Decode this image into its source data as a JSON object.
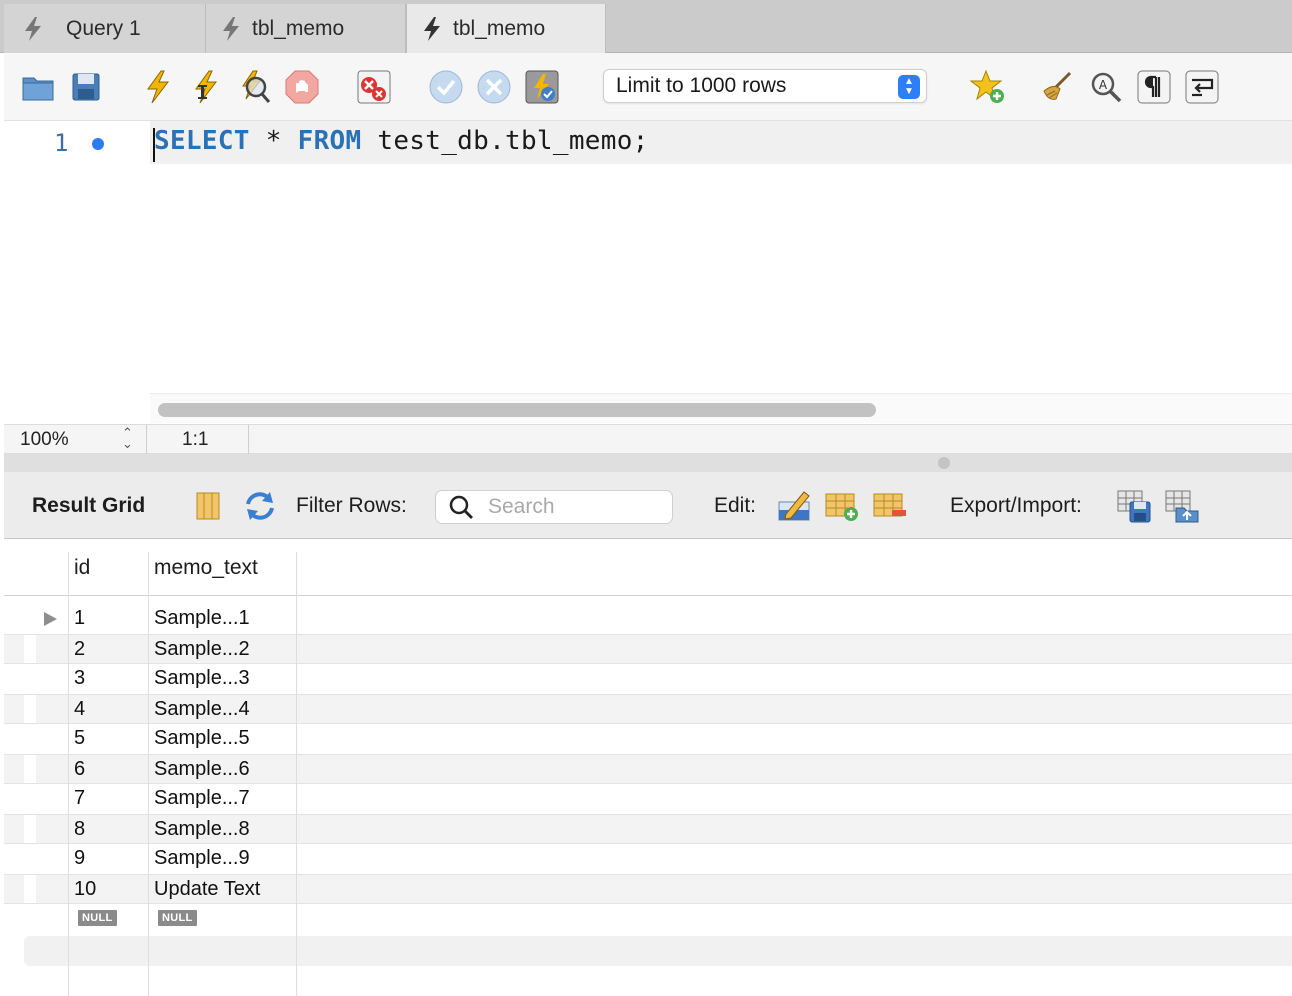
{
  "tabs": [
    {
      "label": "Query 1",
      "active": false
    },
    {
      "label": "tbl_memo",
      "active": false
    },
    {
      "label": "tbl_memo",
      "active": true
    }
  ],
  "toolbar": {
    "icons": [
      "open-folder-icon",
      "save-icon",
      "execute-icon",
      "execute-current-icon",
      "explain-icon",
      "stop-icon",
      "toggle-continue-on-error-icon",
      "commit-icon",
      "rollback-icon",
      "autocommit-icon",
      "add-snippet-icon",
      "beautify-icon",
      "find-icon",
      "invisible-chars-icon",
      "word-wrap-icon"
    ],
    "limit_label": "Limit to 1000 rows"
  },
  "editor": {
    "line_number": "1",
    "code_keyword1": "SELECT",
    "code_mid": " * ",
    "code_keyword2": "FROM",
    "code_rest": " test_db.tbl_memo;"
  },
  "statusbar": {
    "zoom": "100%",
    "position": "1:1"
  },
  "result": {
    "title": "Result Grid",
    "filter_label": "Filter Rows:",
    "search_placeholder": "Search",
    "edit_label": "Edit:",
    "export_label": "Export/Import:",
    "columns": [
      "id",
      "memo_text"
    ],
    "rows": [
      {
        "id": "1",
        "memo_text": "Sample...1"
      },
      {
        "id": "2",
        "memo_text": "Sample...2"
      },
      {
        "id": "3",
        "memo_text": "Sample...3"
      },
      {
        "id": "4",
        "memo_text": "Sample...4"
      },
      {
        "id": "5",
        "memo_text": "Sample...5"
      },
      {
        "id": "6",
        "memo_text": "Sample...6"
      },
      {
        "id": "7",
        "memo_text": "Sample...7"
      },
      {
        "id": "8",
        "memo_text": "Sample...8"
      },
      {
        "id": "9",
        "memo_text": "Sample...9"
      },
      {
        "id": "10",
        "memo_text": "Update Text"
      }
    ],
    "null_label": "NULL"
  },
  "colors": {
    "keyword": "#2a72b5",
    "accent": "#2f7ef7",
    "bolt": "#f0b400"
  }
}
